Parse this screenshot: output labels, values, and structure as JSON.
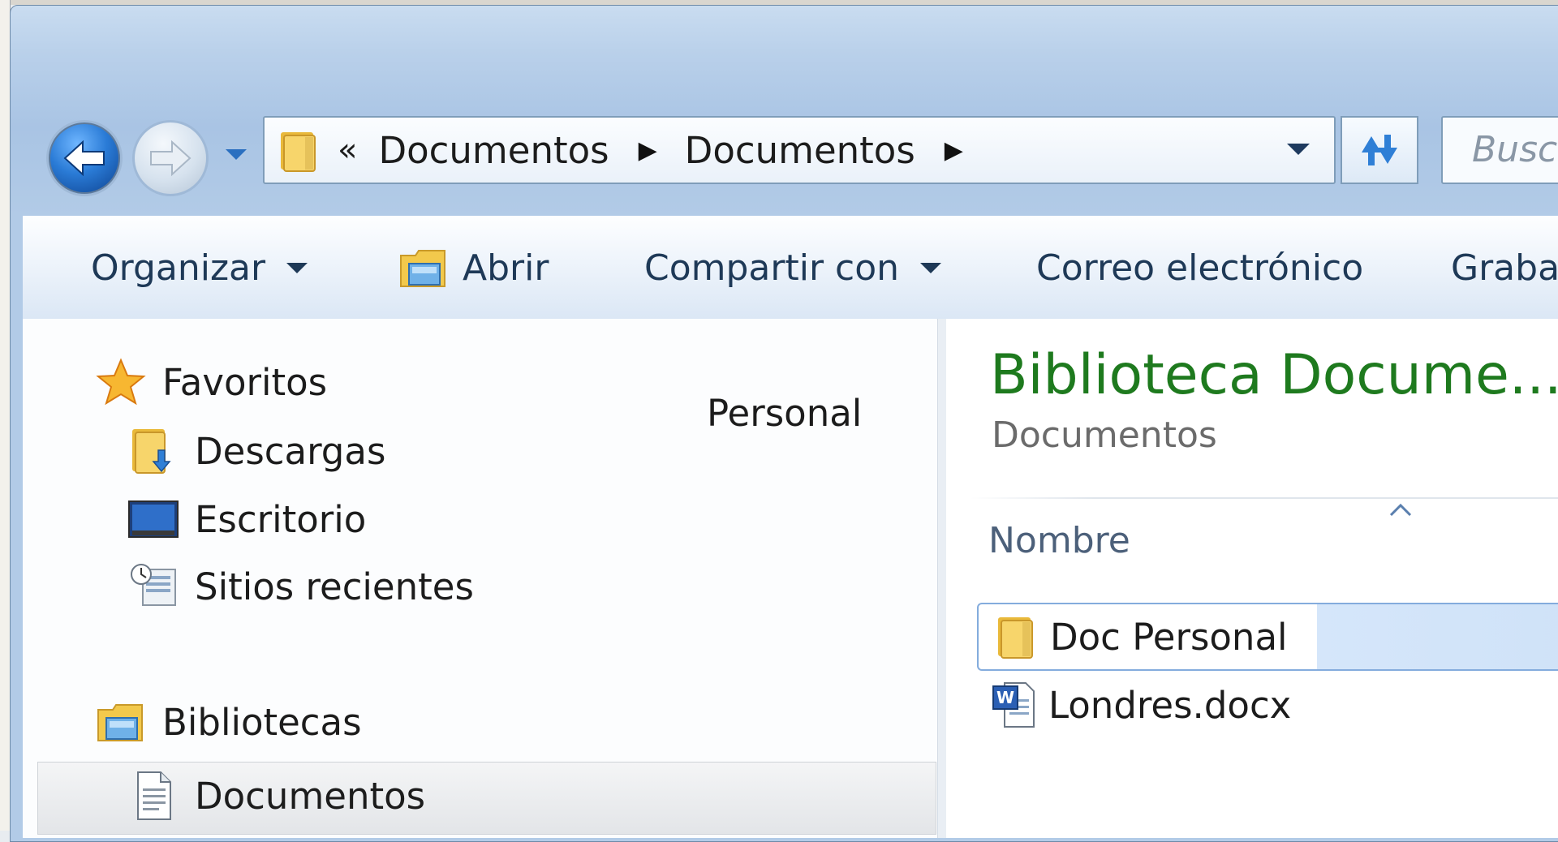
{
  "address_bar": {
    "overflow": "«",
    "crumbs": [
      "Documentos",
      "Documentos"
    ]
  },
  "search": {
    "placeholder": "Busca"
  },
  "toolbar": {
    "organize": "Organizar",
    "open": "Abrir",
    "share": "Compartir con",
    "email": "Correo electrónico",
    "burn": "Grabar"
  },
  "navpane": {
    "favorites": "Favoritos",
    "downloads": "Descargas",
    "desktop": "Escritorio",
    "recent": "Sitios recientes",
    "libraries": "Bibliotecas",
    "documents": "Documentos",
    "floating_label": "Personal"
  },
  "content": {
    "title": "Biblioteca Docume...",
    "subtitle": "Documentos",
    "column_name": "Nombre",
    "files": [
      {
        "name": "Doc Personal",
        "type": "folder"
      },
      {
        "name": "Londres.docx",
        "type": "word-document"
      }
    ]
  },
  "colors": {
    "title_green": "#1e7a1e",
    "toolbar_text": "#1e3957",
    "selection_blue": "#cfe2f8"
  }
}
